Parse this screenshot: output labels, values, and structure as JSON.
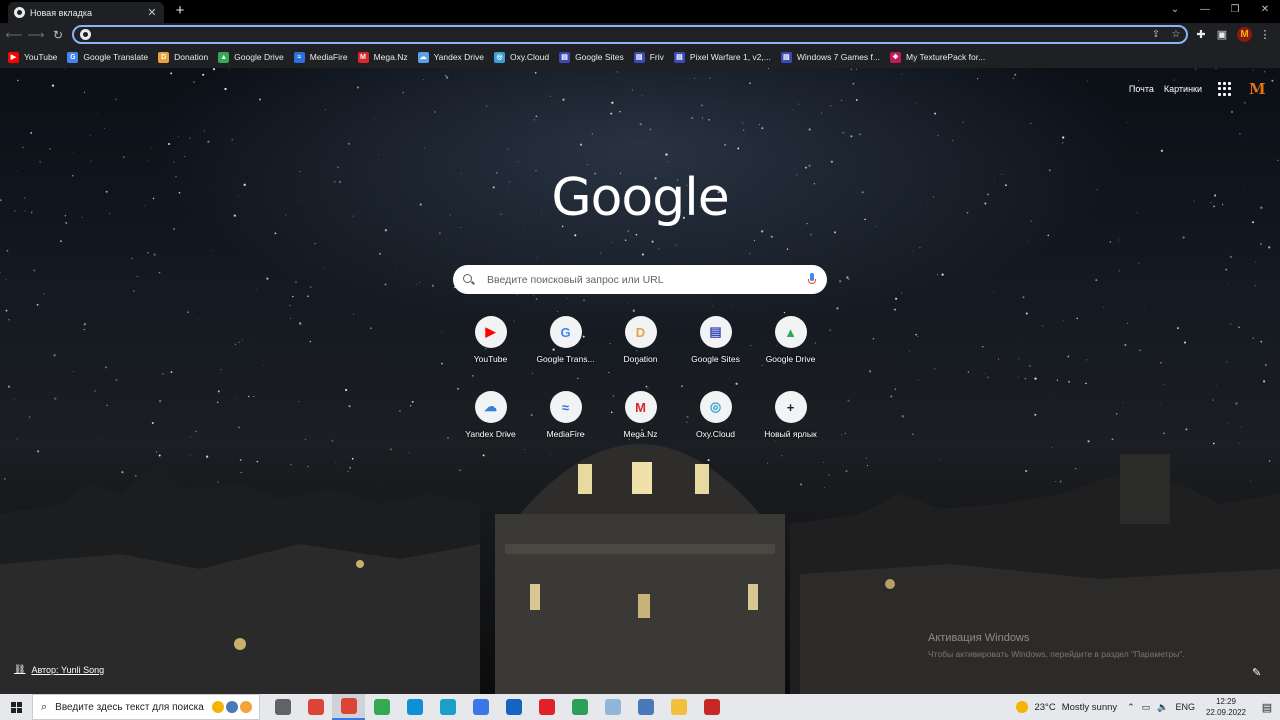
{
  "browser": {
    "tab_title": "Новая вкладка",
    "tab_close": "✕",
    "new_tab": "+",
    "window_controls": [
      "⌄",
      "—",
      "❐",
      "✕"
    ]
  },
  "toolbar": {
    "omnibox_value": "",
    "icons": [
      "share-icon",
      "star-icon",
      "extensions-icon",
      "side-panel-icon",
      "profile-avatar",
      "menu-icon"
    ],
    "profile_letter": "M"
  },
  "bookmarks": [
    {
      "label": "YouTube",
      "icon": "youtube-icon",
      "color": "#ff0000",
      "glyph": "▶"
    },
    {
      "label": "Google Translate",
      "icon": "translate-icon",
      "color": "#4285f4",
      "glyph": "G"
    },
    {
      "label": "Donation",
      "icon": "donation-icon",
      "color": "#e8a33d",
      "glyph": "D"
    },
    {
      "label": "Google Drive",
      "icon": "drive-icon",
      "color": "#34a853",
      "glyph": "▲"
    },
    {
      "label": "MediaFire",
      "icon": "mediafire-icon",
      "color": "#2f6fdc",
      "glyph": "≈"
    },
    {
      "label": "Mega.Nz",
      "icon": "mega-icon",
      "color": "#d9272e",
      "glyph": "M"
    },
    {
      "label": "Yandex Drive",
      "icon": "yandex-icon",
      "color": "#5aa0e6",
      "glyph": "☁"
    },
    {
      "label": "Oxy.Cloud",
      "icon": "oxycloud-icon",
      "color": "#3aa0d8",
      "glyph": "◎"
    },
    {
      "label": "Google Sites",
      "icon": "sites-icon",
      "color": "#3c4ab9",
      "glyph": "▤"
    },
    {
      "label": "Friv",
      "icon": "friv-icon",
      "color": "#3c4ab9",
      "glyph": "▤"
    },
    {
      "label": "Pixel Warfare 1, v2,...",
      "icon": "page-icon",
      "color": "#3c4ab9",
      "glyph": "▤"
    },
    {
      "label": "Windows 7 Games f...",
      "icon": "page-icon",
      "color": "#3c4ab9",
      "glyph": "▤"
    },
    {
      "label": "My TexturePack for...",
      "icon": "texturepack-icon",
      "color": "#c2185b",
      "glyph": "❖"
    }
  ],
  "ntp": {
    "links": [
      "Почта",
      "Картинки"
    ],
    "avatar_letter": "M",
    "logo": "Google",
    "search_placeholder": "Введите поисковый запрос или URL",
    "shortcuts": [
      {
        "label": "YouTube",
        "icon": "youtube-icon",
        "color": "#ff0000",
        "glyph": "▶"
      },
      {
        "label": "Google Trans...",
        "icon": "translate-icon",
        "color": "#4285f4",
        "glyph": "G"
      },
      {
        "label": "Donation",
        "icon": "donation-icon",
        "color": "#e8a33d",
        "glyph": "D"
      },
      {
        "label": "Google Sites",
        "icon": "sites-icon",
        "color": "#3c4ab9",
        "glyph": "▤"
      },
      {
        "label": "Google Drive",
        "icon": "drive-icon",
        "color": "#34a853",
        "glyph": "▲"
      },
      {
        "label": "Yandex Drive",
        "icon": "yandex-icon",
        "color": "#2f7fe0",
        "glyph": "☁"
      },
      {
        "label": "MediaFire",
        "icon": "mediafire-icon",
        "color": "#2f6fdc",
        "glyph": "≈"
      },
      {
        "label": "Mega.Nz",
        "icon": "mega-icon",
        "color": "#d9272e",
        "glyph": "M"
      },
      {
        "label": "Oxy.Cloud",
        "icon": "oxycloud-icon",
        "color": "#3aa0d8",
        "glyph": "◎"
      },
      {
        "label": "Новый ярлык",
        "icon": "plus-icon",
        "color": "#202124",
        "glyph": "+"
      }
    ],
    "author": "Автор: Yunli Song",
    "activation_title": "Активация Windows",
    "activation_text": "Чтобы активировать Windows, перейдите в раздел \"Параметры\"."
  },
  "taskbar": {
    "search_placeholder": "Введите здесь текст для поиска",
    "apps": [
      {
        "name": "task-view-icon",
        "color": "#5f6368"
      },
      {
        "name": "chrome-icon",
        "color": "#db4437"
      },
      {
        "name": "chrome-active-icon",
        "color": "#db4437",
        "active": true
      },
      {
        "name": "chrome-green-icon",
        "color": "#34a853"
      },
      {
        "name": "edge-icon",
        "color": "#0f8fd6"
      },
      {
        "name": "store-icon",
        "color": "#1aa0c8"
      },
      {
        "name": "calculator-icon",
        "color": "#3b78e7"
      },
      {
        "name": "mail-icon",
        "color": "#1565c0"
      },
      {
        "name": "opera-icon",
        "color": "#e0202a"
      },
      {
        "name": "app-green-icon",
        "color": "#2e9e5b"
      },
      {
        "name": "feather-icon",
        "color": "#8fb6d8"
      },
      {
        "name": "computer-icon",
        "color": "#4a78b8"
      },
      {
        "name": "folder-icon",
        "color": "#f2c03a"
      },
      {
        "name": "app-red-icon",
        "color": "#c62828"
      }
    ],
    "weather_temp": "23°C",
    "weather_text": "Mostly sunny",
    "lang": "ENG",
    "time": "12:29",
    "date": "22.09.2022"
  }
}
